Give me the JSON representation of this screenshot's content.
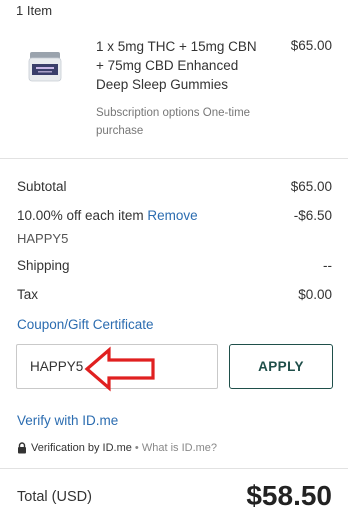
{
  "cart": {
    "item_count": "1 Item",
    "product": {
      "name": "1 x 5mg THC + 15mg CBN + 75mg CBD Enhanced Deep Sleep Gummies",
      "price": "$65.00",
      "subscription": "Subscription options One-time purchase"
    }
  },
  "summary": {
    "subtotal_label": "Subtotal",
    "subtotal_value": "$65.00",
    "discount_label": "10.00% off each item",
    "discount_remove": "Remove",
    "discount_value": "-$6.50",
    "discount_code": "HAPPY5",
    "shipping_label": "Shipping",
    "shipping_value": "--",
    "tax_label": "Tax",
    "tax_value": "$0.00"
  },
  "coupon": {
    "link_label": "Coupon/Gift Certificate",
    "input_value": "HAPPY5",
    "apply_label": "APPLY"
  },
  "verify": {
    "link_label": "Verify with ID.me",
    "note_text": "Verification by ID.me",
    "separator": " • ",
    "what_is": "What is ID.me?"
  },
  "total": {
    "label": "Total (USD)",
    "value": "$58.50"
  },
  "colors": {
    "link": "#2b6cb0",
    "apply_border": "#1f4f4a",
    "arrow": "#e02020"
  },
  "icons": [
    "product-thumbnail",
    "red-arrow-annotation",
    "lock-icon"
  ]
}
